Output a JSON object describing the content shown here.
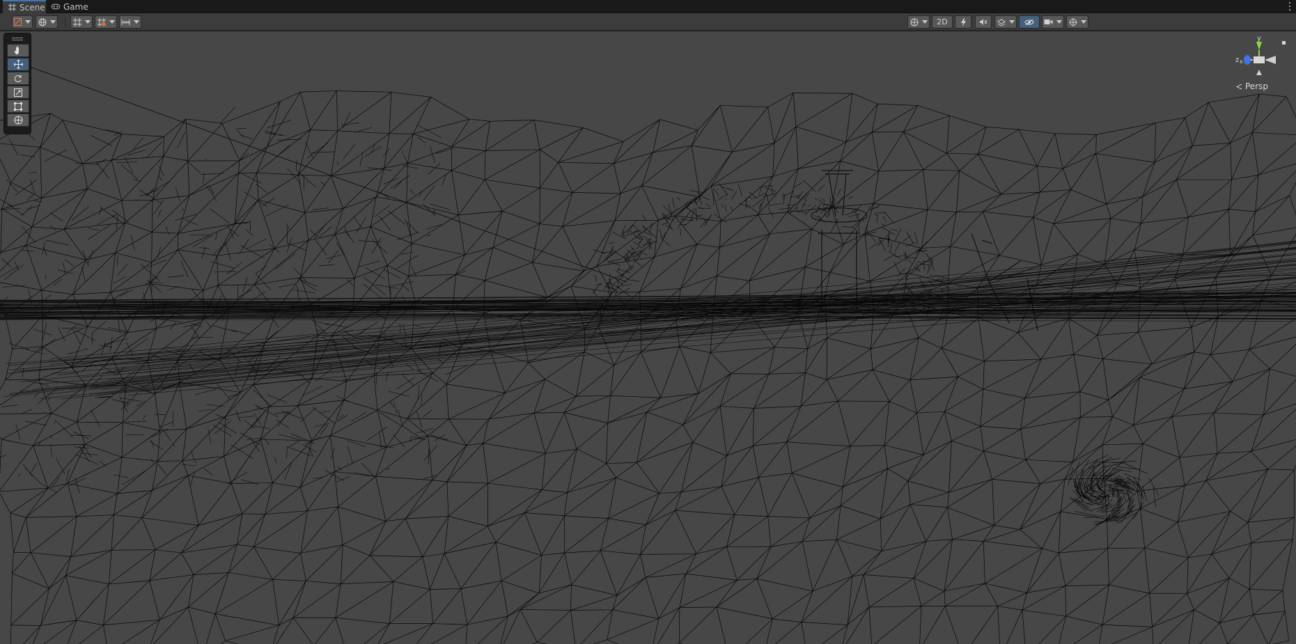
{
  "tabs": [
    {
      "label": "Scene",
      "icon": "grid-icon",
      "active": true
    },
    {
      "label": "Game",
      "icon": "gamepad-icon",
      "active": false
    }
  ],
  "toolbar": {
    "two_d_label": "2D"
  },
  "tools": [
    {
      "name": "hand-tool",
      "active": false
    },
    {
      "name": "move-tool",
      "active": true
    },
    {
      "name": "rotate-tool",
      "active": false
    },
    {
      "name": "scale-tool",
      "active": false
    },
    {
      "name": "rect-tool",
      "active": false
    },
    {
      "name": "transform-tool",
      "active": false
    }
  ],
  "gizmo": {
    "y_label": "y",
    "z_label": "z",
    "x_label": "x",
    "projection_label": "Persp"
  },
  "colors": {
    "viewport": "#474747",
    "wire": "#000000",
    "accent_blue": "#3a79bb",
    "axis_y": "#8ad53e",
    "axis_z": "#3d74e8"
  }
}
